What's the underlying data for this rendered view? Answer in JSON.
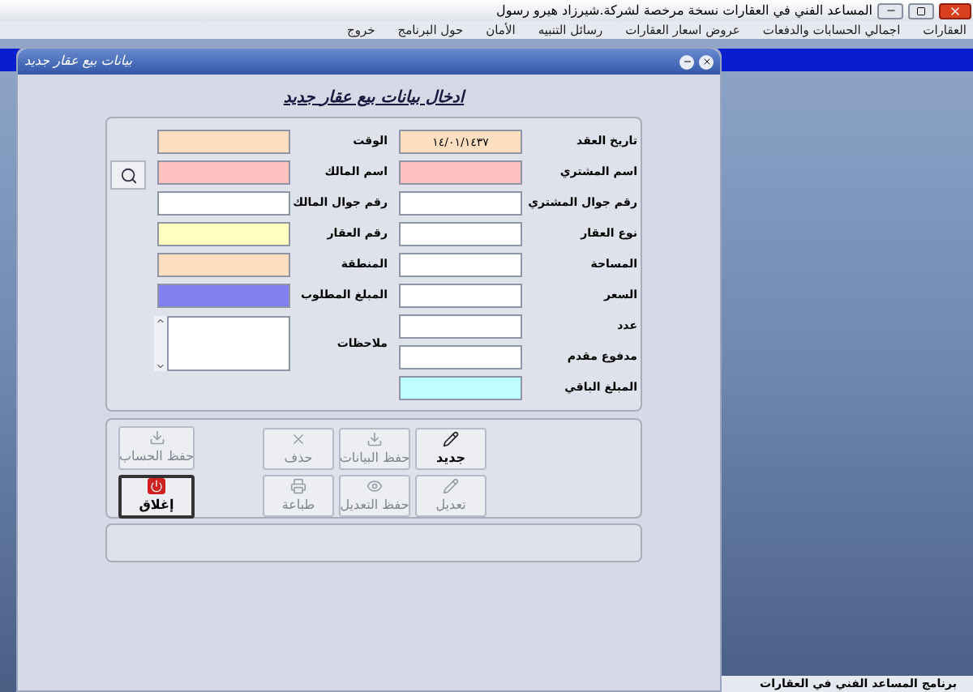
{
  "window": {
    "title": "المساعد الفني في العقارات  نسخة مرخصة  لشركة.شيرزاد هيرو رسول"
  },
  "menu": [
    "العقارات",
    "اجمالي الحسابات والدفعات",
    "عروض اسعار العقارات",
    "رسائل التنبيه",
    "الأمان",
    "حول البرنامج",
    "خروج"
  ],
  "dialog": {
    "title": "بيانات بيع عقار جديد",
    "heading": "ادخال بيانات بيع عقار جديد",
    "right_fields": [
      {
        "label": "تاريخ العقد",
        "value": "١٤/٠١/١٤٣٧",
        "color": "#ffdfbf"
      },
      {
        "label": "اسم المشتري",
        "color": "#ffc0c0"
      },
      {
        "label": "رقم جوال المشتري",
        "color": "#ffffff"
      },
      {
        "label": "نوع العقار",
        "color": "#ffffff"
      },
      {
        "label": "المساحة",
        "color": "#ffffff"
      },
      {
        "label": "السعر",
        "color": "#ffffff"
      },
      {
        "label": "عدد",
        "color": "#ffffff"
      },
      {
        "label": "مدفوع مقدم",
        "color": "#ffffff"
      },
      {
        "label": "المبلغ الباقي",
        "color": "#c0ffff"
      }
    ],
    "left_fields": [
      {
        "label": "الوقت",
        "kind": "text",
        "color": "#ffdfbf"
      },
      {
        "label": "اسم المالك",
        "kind": "text",
        "color": "#ffc0c0"
      },
      {
        "label": "رقم جوال المالك",
        "kind": "text",
        "color": "#ffffff"
      },
      {
        "label": "رقم العقار",
        "kind": "text",
        "color": "#ffffc0"
      },
      {
        "label": "المنطقة",
        "kind": "text",
        "color": "#ffdfbf"
      },
      {
        "label": "المبلغ المطلوب",
        "kind": "text",
        "color": "#8080f0"
      },
      {
        "label": "ملاحظات",
        "kind": "textarea",
        "color": "#ffffff"
      }
    ],
    "action_buttons": [
      {
        "label": "جديد",
        "kind": "new",
        "disabled": false
      },
      {
        "label": "حفظ البيانات",
        "kind": "save",
        "disabled": true
      },
      {
        "label": "حذف",
        "kind": "delete",
        "disabled": true
      },
      {
        "label": "تعديل",
        "kind": "edit",
        "disabled": true
      },
      {
        "label": "حفظ التعديل",
        "kind": "saveedit",
        "disabled": true
      },
      {
        "label": "طباعة",
        "kind": "print",
        "disabled": true
      }
    ],
    "side_buttons": [
      {
        "label": "حفظ الحساب",
        "kind": "save",
        "disabled": true
      },
      {
        "label": "إغلاق",
        "kind": "close",
        "disabled": false
      }
    ]
  },
  "status_bar": {
    "text": "برنامج المساعد الفني في العقارات"
  }
}
